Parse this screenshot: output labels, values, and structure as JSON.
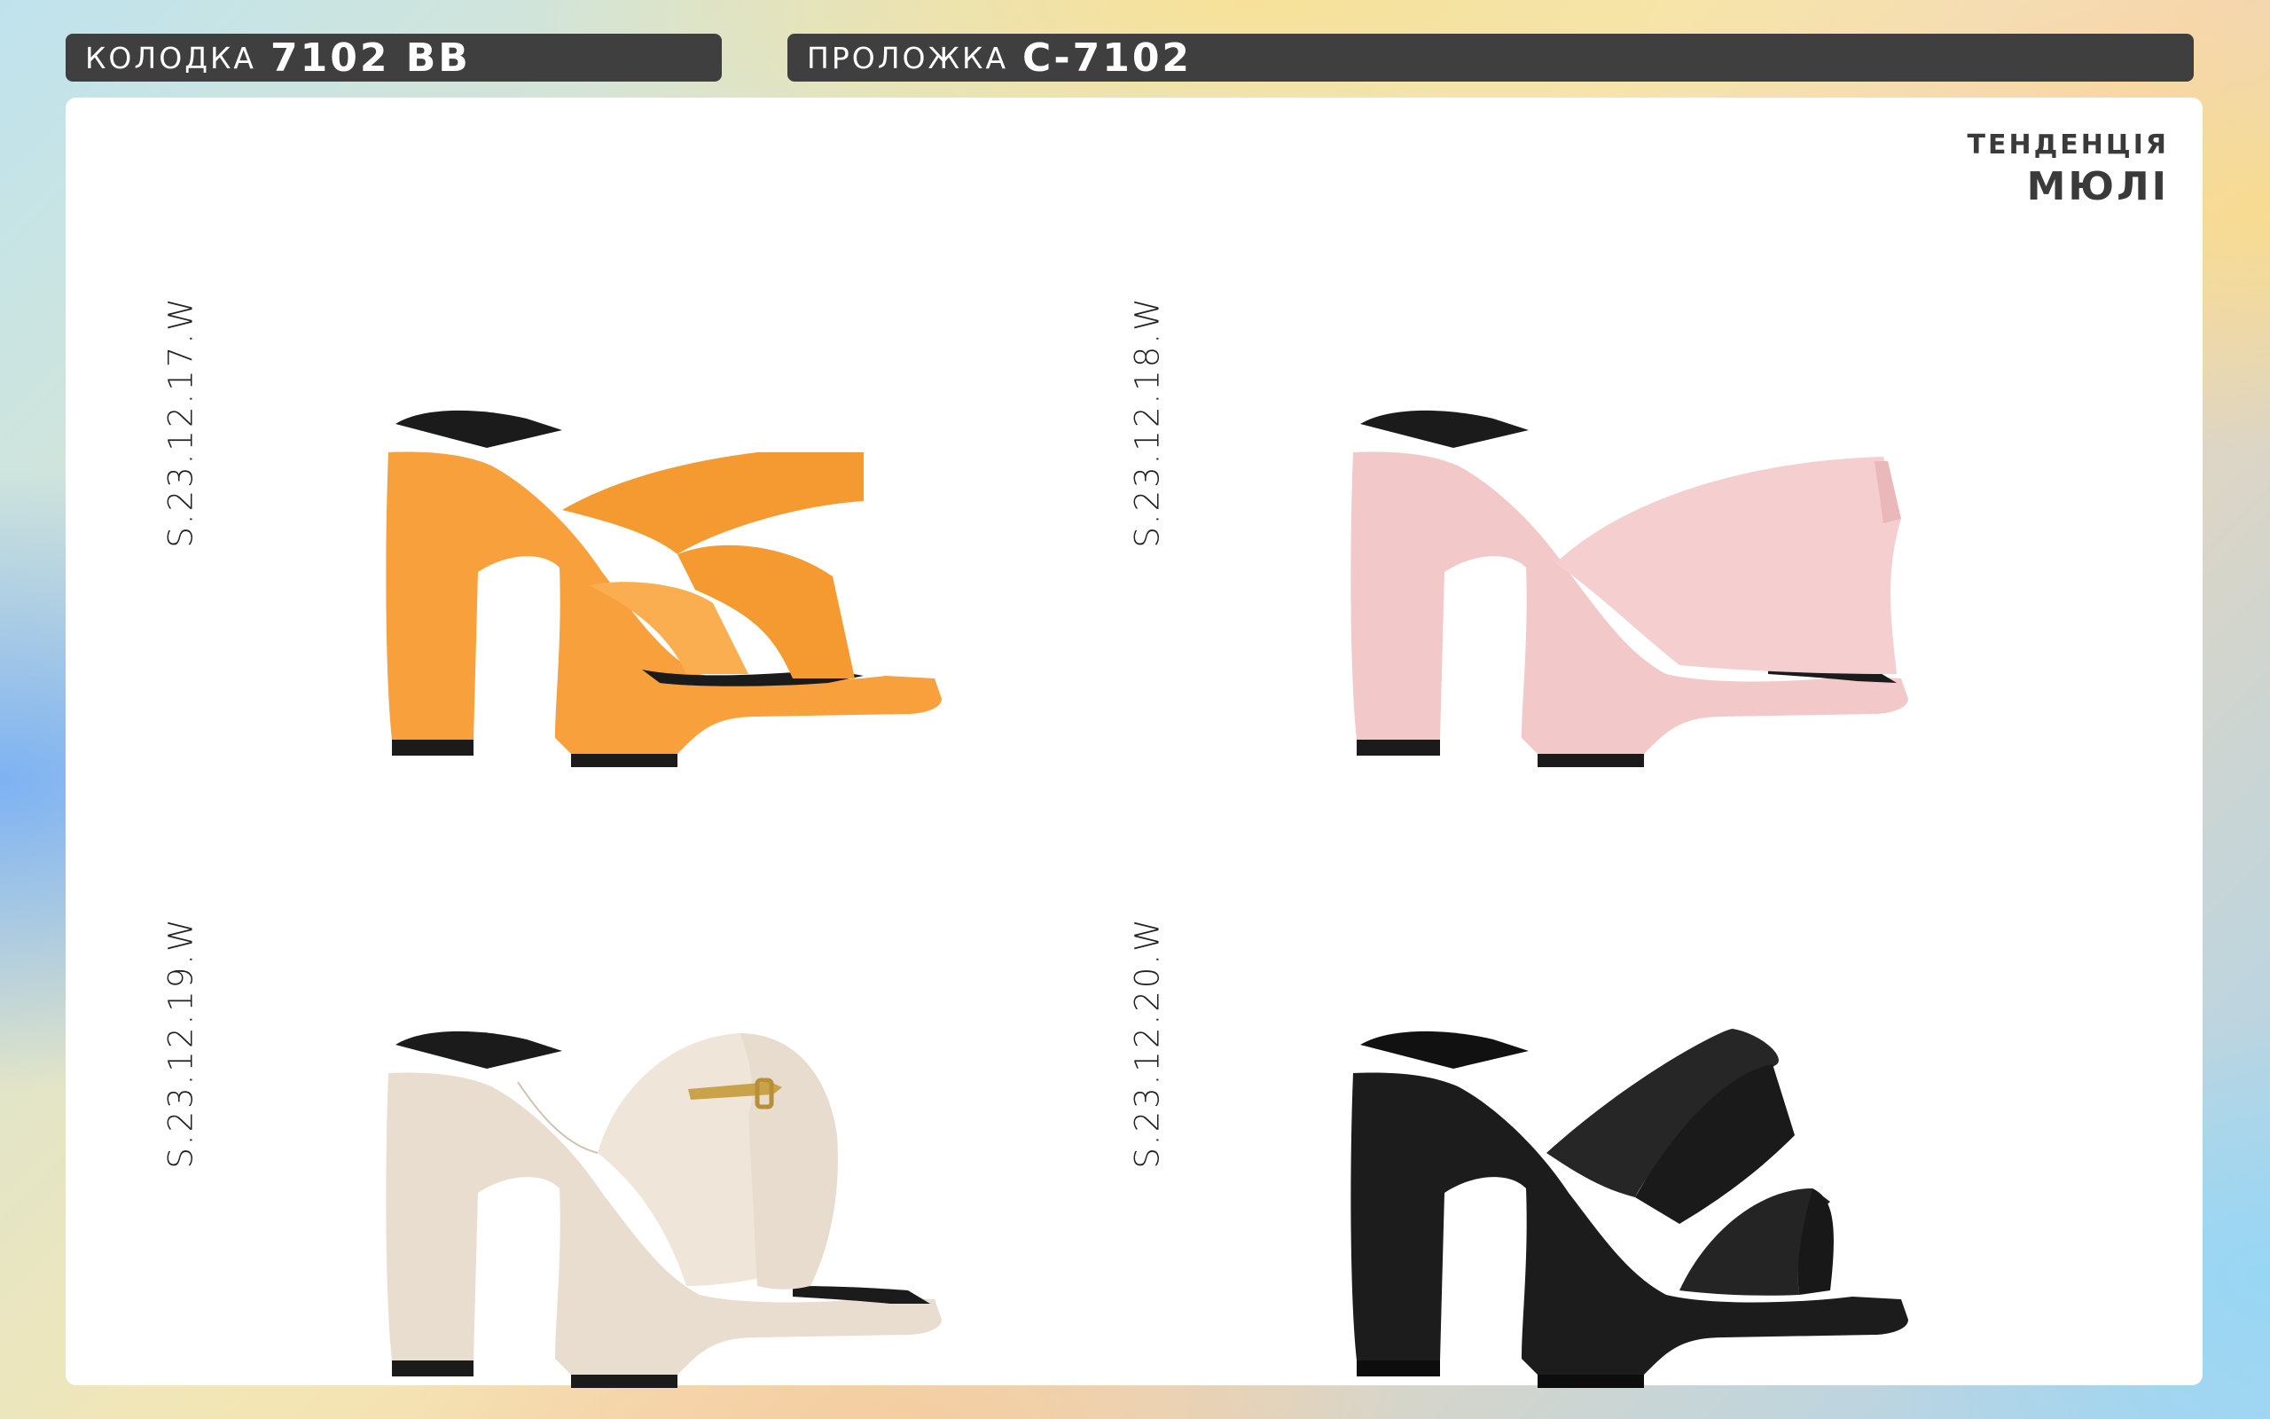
{
  "header": {
    "last": {
      "label": "КОЛОДКА",
      "value": "7102 ВВ"
    },
    "insole": {
      "label": "ПРОЛОЖКА",
      "value": "С-7102"
    }
  },
  "trend": {
    "label": "ТЕНДЕНЦІЯ",
    "value": "МЮЛІ"
  },
  "products": [
    {
      "code": "S.23.12.17.W",
      "color": "#f7a03c",
      "description": "orange crossover-strap platform mule"
    },
    {
      "code": "S.23.12.18.W",
      "color": "#f3c8c8",
      "description": "pink wide-band platform mule"
    },
    {
      "code": "S.23.12.19.W",
      "color": "#e9ddd0",
      "description": "beige platform mule with gold horsebit"
    },
    {
      "code": "S.23.12.20.W",
      "color": "#1c1c1c",
      "description": "black double-strap platform mule"
    }
  ]
}
